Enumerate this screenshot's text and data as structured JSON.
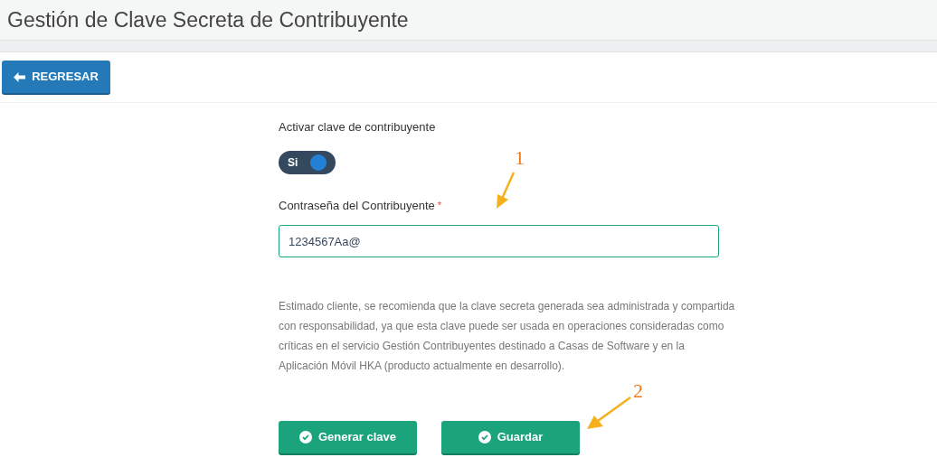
{
  "page": {
    "title": "Gestión de Clave Secreta de Contribuyente"
  },
  "back_button": {
    "label": "REGRESAR"
  },
  "toggle": {
    "label": "Activar clave de contribuyente",
    "text": "Si",
    "on": true
  },
  "password": {
    "label": "Contraseña del Contribuyente",
    "required_mark": "*",
    "value": "1234567Aa@"
  },
  "notice": "Estimado cliente, se recomienda que la clave secreta generada sea administrada y compartida con responsabilidad, ya que esta clave puede ser usada en operaciones consideradas como críticas en el servicio Gestión Contribuyentes destinado a Casas de Software y en la Aplicación Móvil HKA (producto actualmente en desarrollo).",
  "buttons": [
    "Generar clave",
    "Guardar"
  ],
  "annotations": [
    "1",
    "2"
  ]
}
